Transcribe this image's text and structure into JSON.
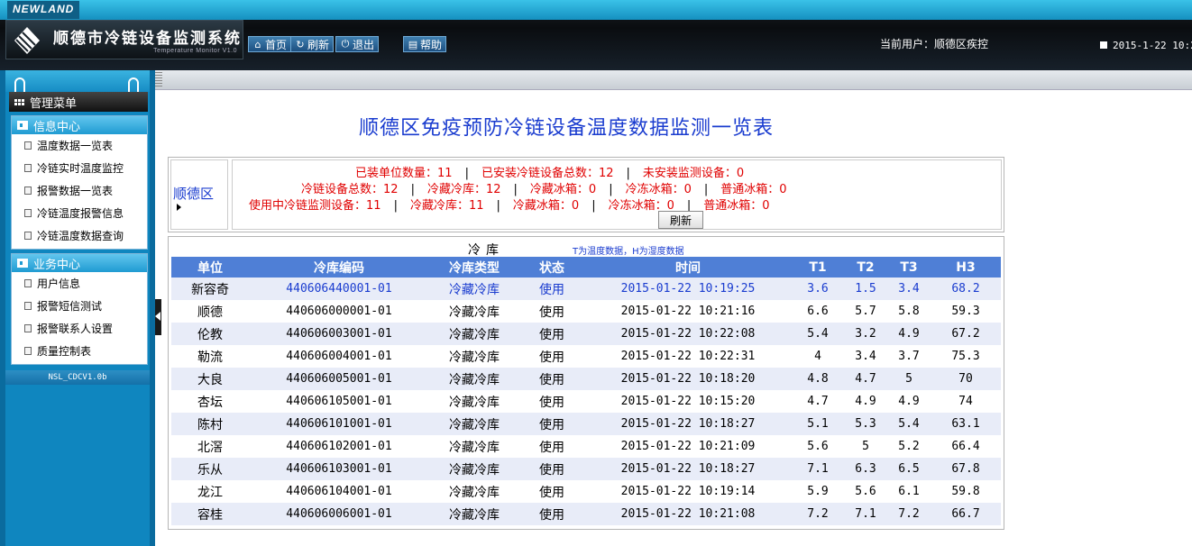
{
  "header": {
    "brand": "NEWLAND",
    "app_title": "顺德市冷链设备监测系统",
    "app_subtitle": "Temperature Monitor V1.0",
    "buttons": {
      "home": "首页",
      "refresh": "刷新",
      "logout": "退出",
      "help": "帮助"
    },
    "current_user_label": "当前用户：顺德区疾控",
    "datetime": "2015-1-22 10:20"
  },
  "sidebar": {
    "menu_title": "管理菜单",
    "sections": [
      {
        "title": "信息中心",
        "items": [
          "温度数据一览表",
          "冷链实时温度监控",
          "报警数据一览表",
          "冷链温度报警信息",
          "冷链温度数据查询"
        ]
      },
      {
        "title": "业务中心",
        "items": [
          "用户信息",
          "报警短信测试",
          "报警联系人设置",
          "质量控制表"
        ]
      }
    ],
    "version": "NSL_CDCV1.0b"
  },
  "main": {
    "page_title": "顺德区免疫预防冷链设备温度数据监测一览表",
    "summary": {
      "district": "顺德区",
      "installed_units_label": "已装单位数量：",
      "installed_units": "11",
      "installed_devices_label": "已安装冷链设备总数：",
      "installed_devices": "12",
      "uninstalled_label": "未安装监测设备：",
      "uninstalled": "0",
      "total_devices_label": "冷链设备总数：",
      "total_devices": "12",
      "cold_storage_label": "冷藏冷库：",
      "cold_storage": "12",
      "fridge_label": "冷藏冰箱：",
      "fridge": "0",
      "freezer_label": "冷冻冰箱：",
      "freezer": "0",
      "normal_fridge_label": "普通冰箱：",
      "normal_fridge": "0",
      "in_use_label": "使用中冷链监测设备：",
      "in_use": "11",
      "in_use_cold_storage_label": "冷藏冷库：",
      "in_use_cold_storage": "11",
      "in_use_fridge_label": "冷藏冰箱：",
      "in_use_fridge": "0",
      "in_use_freezer_label": "冷冻冰箱：",
      "in_use_freezer": "0",
      "in_use_normal_fridge_label": "普通冰箱：",
      "in_use_normal_fridge": "0",
      "refresh_label": "刷新"
    },
    "table": {
      "caption": "冷库",
      "note": "T为温度数据，H为湿度数据",
      "columns": [
        "单位",
        "冷库编码",
        "冷库类型",
        "状态",
        "时间",
        "T1",
        "T2",
        "T3",
        "H3"
      ],
      "rows": [
        [
          "新容奇",
          "440606440001-01",
          "冷藏冷库",
          "使用",
          "2015-01-22 10:19:25",
          "3.6",
          "1.5",
          "3.4",
          "68.2"
        ],
        [
          "顺德",
          "440606000001-01",
          "冷藏冷库",
          "使用",
          "2015-01-22 10:21:16",
          "6.6",
          "5.7",
          "5.8",
          "59.3"
        ],
        [
          "伦教",
          "440606003001-01",
          "冷藏冷库",
          "使用",
          "2015-01-22 10:22:08",
          "5.4",
          "3.2",
          "4.9",
          "67.2"
        ],
        [
          "勒流",
          "440606004001-01",
          "冷藏冷库",
          "使用",
          "2015-01-22 10:22:31",
          "4",
          "3.4",
          "3.7",
          "75.3"
        ],
        [
          "大良",
          "440606005001-01",
          "冷藏冷库",
          "使用",
          "2015-01-22 10:18:20",
          "4.8",
          "4.7",
          "5",
          "70"
        ],
        [
          "杏坛",
          "440606105001-01",
          "冷藏冷库",
          "使用",
          "2015-01-22 10:15:20",
          "4.7",
          "4.9",
          "4.9",
          "74"
        ],
        [
          "陈村",
          "440606101001-01",
          "冷藏冷库",
          "使用",
          "2015-01-22 10:18:27",
          "5.1",
          "5.3",
          "5.4",
          "63.1"
        ],
        [
          "北滘",
          "440606102001-01",
          "冷藏冷库",
          "使用",
          "2015-01-22 10:21:09",
          "5.6",
          "5",
          "5.2",
          "66.4"
        ],
        [
          "乐从",
          "440606103001-01",
          "冷藏冷库",
          "使用",
          "2015-01-22 10:18:27",
          "7.1",
          "6.3",
          "6.5",
          "67.8"
        ],
        [
          "龙江",
          "440606104001-01",
          "冷藏冷库",
          "使用",
          "2015-01-22 10:19:14",
          "5.9",
          "5.6",
          "6.1",
          "59.8"
        ],
        [
          "容桂",
          "440606006001-01",
          "冷藏冷库",
          "使用",
          "2015-01-22 10:21:08",
          "7.2",
          "7.1",
          "7.2",
          "66.7"
        ]
      ]
    }
  }
}
